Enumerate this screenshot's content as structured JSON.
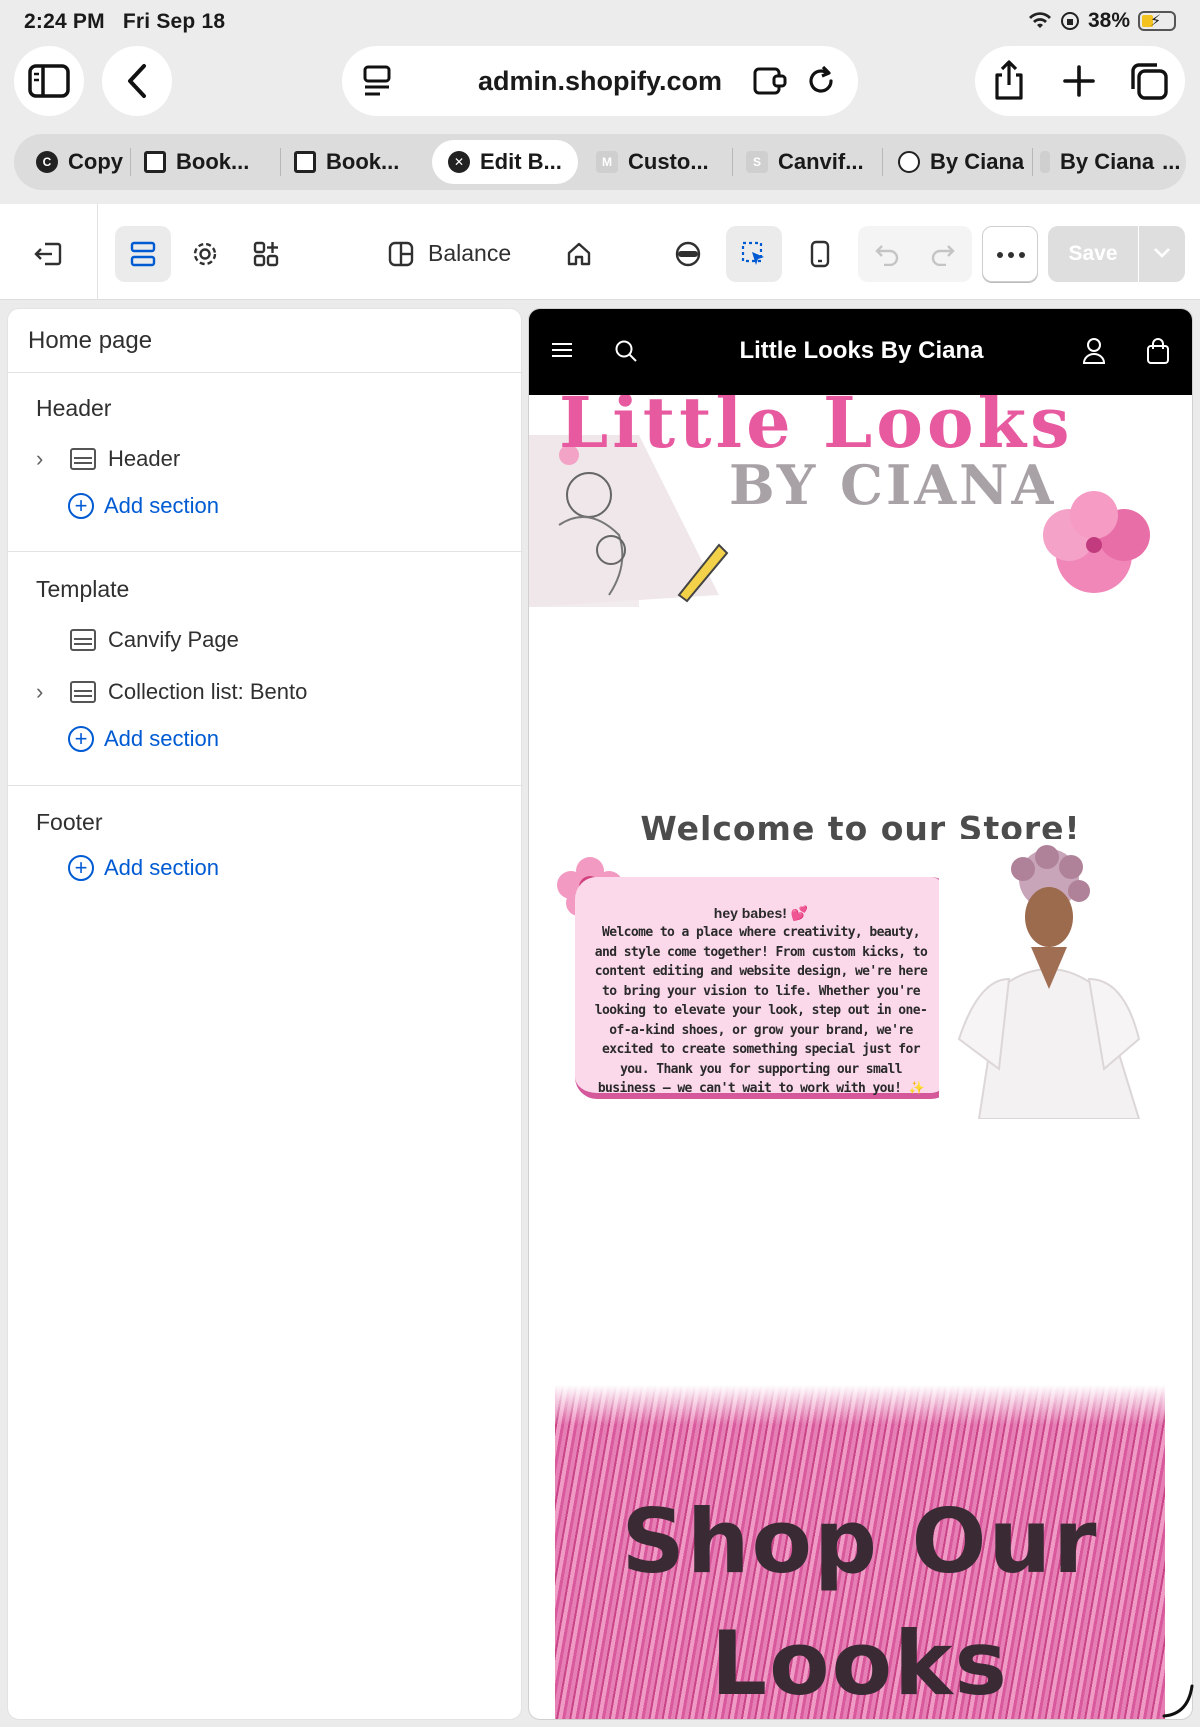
{
  "status_bar": {
    "time": "2:24 PM",
    "date": "Fri Sep 18",
    "battery": "38%",
    "battery_level": 0.38
  },
  "browser": {
    "url": "admin.shopify.com",
    "tabs": [
      {
        "label": "Copy",
        "icon": "circle-c-icon"
      },
      {
        "label": "Book...",
        "icon": "square-icon"
      },
      {
        "label": "Book...",
        "icon": "square-icon"
      },
      {
        "label": "Edit B...",
        "icon": "close-circle-icon",
        "active": true
      },
      {
        "label": "Custo...",
        "icon": "m-icon"
      },
      {
        "label": "Canvif...",
        "icon": "s-icon"
      },
      {
        "label": "By Ciana",
        "icon": "globe-icon"
      },
      {
        "label": "By Ciana",
        "icon": "m-icon"
      }
    ],
    "tab_overflow": "..."
  },
  "editor": {
    "theme_name": "Balance",
    "save_label": "Save"
  },
  "panel": {
    "title": "Home page",
    "groups": [
      {
        "title": "Header",
        "items": [
          {
            "label": "Header",
            "expandable": true
          }
        ],
        "add_label": "Add section"
      },
      {
        "title": "Template",
        "items": [
          {
            "label": "Canvify Page",
            "expandable": false
          },
          {
            "label": "Collection list: Bento",
            "expandable": true
          }
        ],
        "add_label": "Add section"
      },
      {
        "title": "Footer",
        "items": [],
        "add_label": "Add section"
      }
    ]
  },
  "preview": {
    "store_name": "Little Looks By Ciana",
    "logo_main": "Little Looks",
    "logo_sub": "BY CIANA",
    "welcome_heading": "Welcome to our Store!",
    "welcome_greeting": "hey babes! 💕",
    "welcome_body": "Welcome to a place where creativity, beauty, and style come together! From custom kicks, to content editing and website design, we're here to bring your vision to life. Whether you're looking to elevate your look, step out in one-of-a-kind shoes, or grow your brand, we're excited to create something special just for you. Thank you for supporting our small business – we can't wait to work with you! ✨",
    "shop_heading_line1": "Shop Our",
    "shop_heading_line2": "Looks"
  },
  "colors": {
    "accent": "#005bd3",
    "store_header": "#000000",
    "card_bg": "#fbd9eb",
    "card_border": "#d4589a"
  }
}
